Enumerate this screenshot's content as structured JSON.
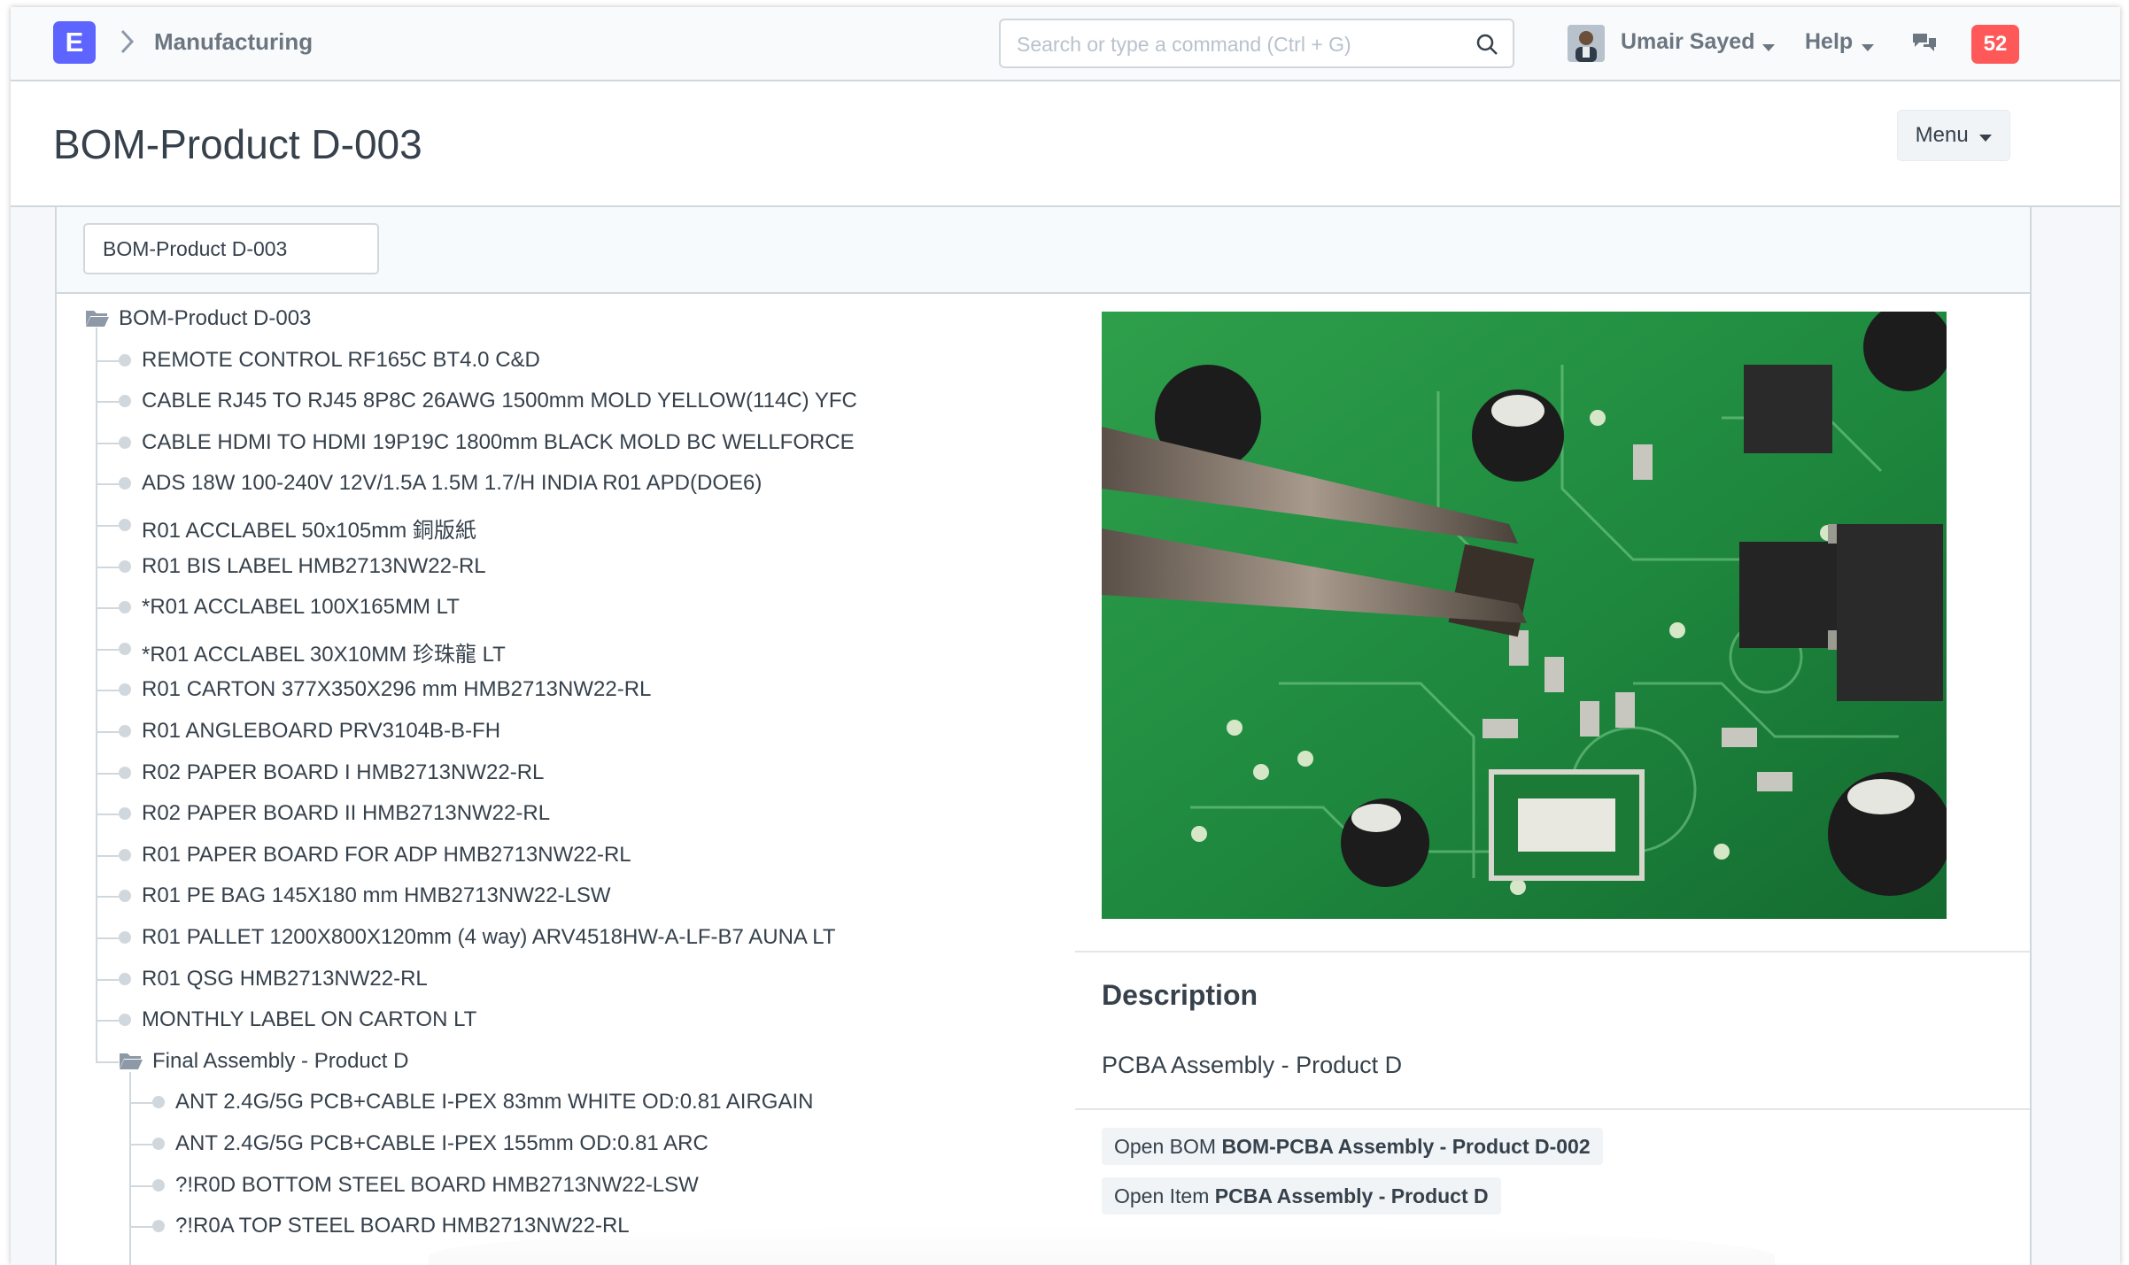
{
  "navbar": {
    "logo_letter": "E",
    "breadcrumb": "Manufacturing",
    "search_placeholder": "Search or type a command (Ctrl + G)",
    "user_name": "Umair Sayed",
    "help_label": "Help",
    "notification_count": "52"
  },
  "page": {
    "title": "BOM-Product D-003",
    "menu_label": "Menu"
  },
  "filter": {
    "bom_value": "BOM-Product D-003"
  },
  "tree": {
    "root_label": "BOM-Product D-003",
    "items": [
      "REMOTE CONTROL RF165C BT4.0 C&D",
      "CABLE RJ45 TO RJ45 8P8C 26AWG 1500mm MOLD YELLOW(114C) YFC",
      "CABLE HDMI TO HDMI 19P19C 1800mm BLACK MOLD BC WELLFORCE",
      "ADS 18W 100-240V 12V/1.5A 1.5M 1.7/H INDIA R01 APD(DOE6)",
      "R01 ACCLABEL 50x105mm 銅版紙",
      "R01 BIS LABEL HMB2713NW22-RL",
      "*R01 ACCLABEL 100X165MM LT",
      "*R01 ACCLABEL 30X10MM 珍珠龍 LT",
      "R01 CARTON 377X350X296 mm HMB2713NW22-RL",
      "R01 ANGLEBOARD PRV3104B-B-FH",
      "R02 PAPER BOARD I HMB2713NW22-RL",
      "R02 PAPER BOARD II HMB2713NW22-RL",
      "R01 PAPER BOARD FOR ADP HMB2713NW22-RL",
      "R01 PE BAG 145X180 mm HMB2713NW22-LSW",
      "R01 PALLET 1200X800X120mm (4 way) ARV4518HW-A-LF-B7 AUNA LT",
      "R01 QSG HMB2713NW22-RL",
      "MONTHLY LABEL ON CARTON LT"
    ],
    "subfolder_label": "Final Assembly - Product D",
    "subitems": [
      "ANT 2.4G/5G PCB+CABLE I-PEX 83mm WHITE OD:0.81 AIRGAIN",
      "ANT 2.4G/5G PCB+CABLE I-PEX 155mm OD:0.81 ARC",
      "?!R0D BOTTOM STEEL BOARD HMB2713NW22-LSW",
      "?!R0A TOP STEEL BOARD HMB2713NW22-RL"
    ]
  },
  "details": {
    "description_heading": "Description",
    "description_text": "PCBA Assembly - Product D",
    "open_bom_prefix": "Open BOM",
    "open_bom_name": "BOM-PCBA Assembly - Product D-002",
    "open_item_prefix": "Open Item",
    "open_item_name": "PCBA Assembly - Product D"
  },
  "colors": {
    "brand": "#5e64ff",
    "notification": "#ff5858",
    "text": "#36414c",
    "muted": "#6c7680",
    "border": "#d1d8dd"
  },
  "icons": [
    "chevron-right-icon",
    "search-icon",
    "caret-down-icon",
    "chat-icon",
    "folder-open-icon"
  ]
}
